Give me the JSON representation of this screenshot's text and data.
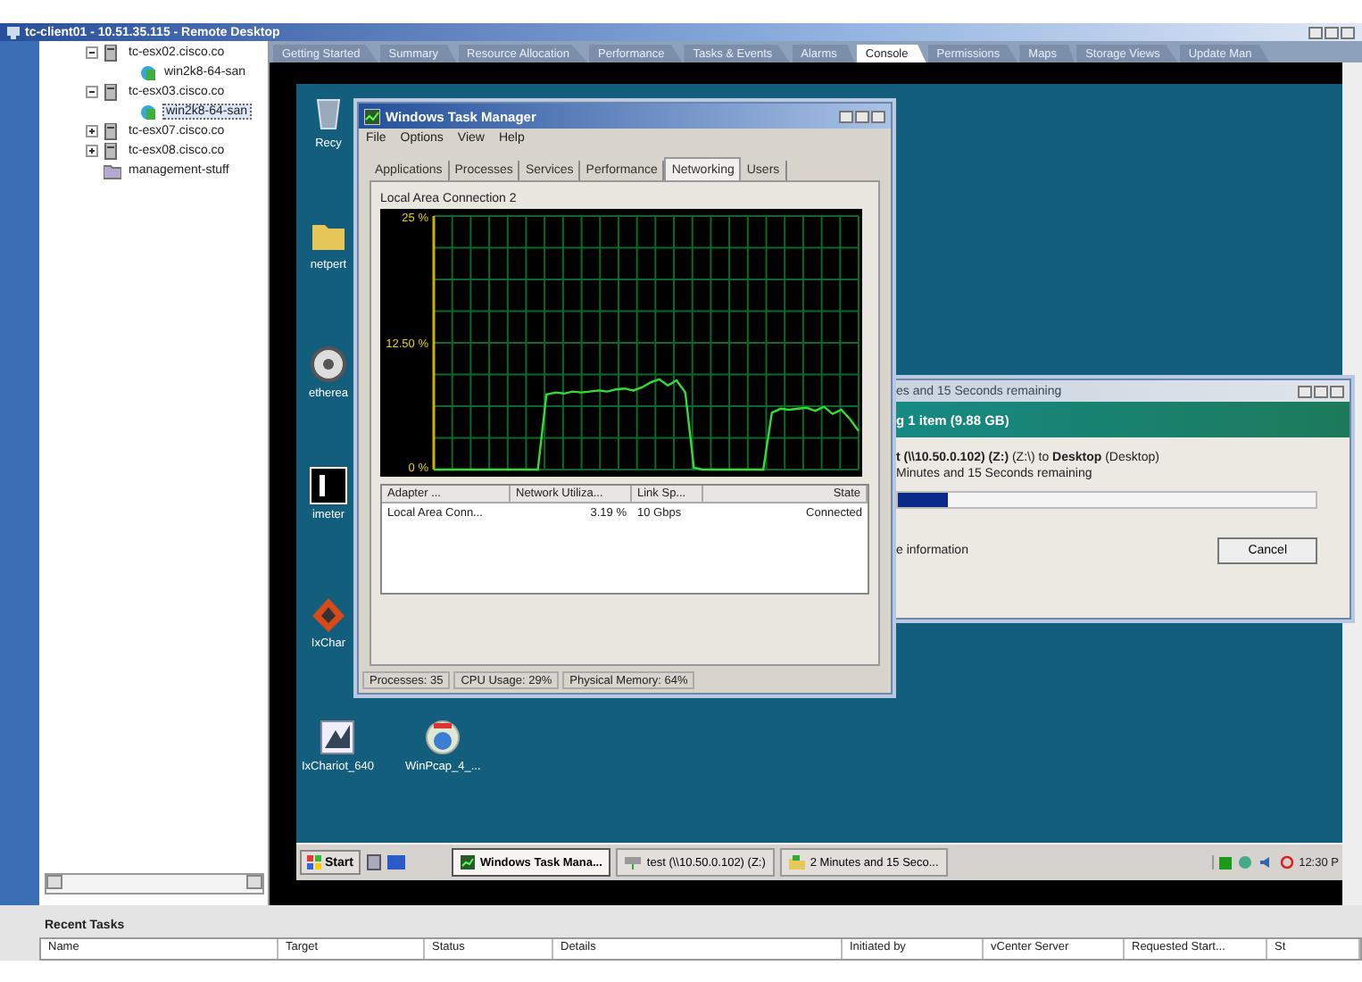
{
  "remote_desktop": {
    "title": "tc-client01 - 10.51.35.115 - Remote Desktop"
  },
  "inventory_tree": [
    {
      "label": "tc-esx02.cisco.co",
      "kind": "host",
      "expanded": true,
      "selected": false,
      "children": [
        {
          "label": "win2k8-64-san",
          "kind": "vm",
          "selected": false
        }
      ]
    },
    {
      "label": "tc-esx03.cisco.co",
      "kind": "host",
      "expanded": true,
      "selected": false,
      "children": [
        {
          "label": "win2k8-64-san",
          "kind": "vm",
          "selected": true
        }
      ]
    },
    {
      "label": "tc-esx07.cisco.co",
      "kind": "host",
      "expanded": false,
      "selected": false
    },
    {
      "label": "tc-esx08.cisco.co",
      "kind": "host",
      "expanded": false,
      "selected": false
    },
    {
      "label": "management-stuff",
      "kind": "folder",
      "selected": false
    }
  ],
  "tabs": [
    {
      "label": "Getting Started",
      "selected": false
    },
    {
      "label": "Summary",
      "selected": false
    },
    {
      "label": "Resource Allocation",
      "selected": false
    },
    {
      "label": "Performance",
      "selected": false
    },
    {
      "label": "Tasks & Events",
      "selected": false
    },
    {
      "label": "Alarms",
      "selected": false
    },
    {
      "label": "Console",
      "selected": true
    },
    {
      "label": "Permissions",
      "selected": false
    },
    {
      "label": "Maps",
      "selected": false
    },
    {
      "label": "Storage Views",
      "selected": false
    },
    {
      "label": "Update Man",
      "selected": false
    }
  ],
  "desktop": {
    "side_icons": [
      {
        "label": "Recy",
        "kind": "recycle"
      },
      {
        "label": "netpert",
        "kind": "folder"
      },
      {
        "label": "etherea",
        "kind": "disc"
      },
      {
        "label": "imeter",
        "kind": "tile"
      },
      {
        "label": "IxChar",
        "kind": "app"
      }
    ],
    "bottom_icons": [
      {
        "label": "IxChariot_640",
        "kind": "chart"
      },
      {
        "label": "WinPcap_4_...",
        "kind": "globe"
      }
    ]
  },
  "task_manager": {
    "title": "Windows Task Manager",
    "menu": [
      "File",
      "Options",
      "View",
      "Help"
    ],
    "tabs": [
      {
        "label": "Applications",
        "selected": false
      },
      {
        "label": "Processes",
        "selected": false
      },
      {
        "label": "Services",
        "selected": false
      },
      {
        "label": "Performance",
        "selected": false
      },
      {
        "label": "Networking",
        "selected": true
      },
      {
        "label": "Users",
        "selected": false
      }
    ],
    "group_label": "Local Area Connection 2",
    "chart_data": {
      "type": "line",
      "grid": true,
      "ylim": [
        0,
        25
      ],
      "yticks": [
        {
          "value": 0,
          "label": "0 %"
        },
        {
          "value": 12.5,
          "label": "12.50 %"
        },
        {
          "value": 25,
          "label": "25 %"
        }
      ],
      "series": [
        {
          "color": "#33dd33",
          "values": [
            0,
            0,
            0,
            0,
            0,
            0,
            0,
            0,
            0,
            0,
            0,
            0,
            0,
            7.4,
            7.6,
            7.5,
            7.7,
            7.6,
            7.7,
            7.8,
            7.7,
            7.9,
            8.0,
            7.8,
            8.1,
            8.6,
            8.9,
            8.3,
            8.8,
            7.6,
            0.2,
            0,
            0,
            0,
            0,
            0,
            0,
            0,
            0,
            5.6,
            6.0,
            5.9,
            6.0,
            6.1,
            5.8,
            6.2,
            5.5,
            5.9,
            5.0,
            3.8
          ]
        }
      ]
    },
    "columns": [
      "Adapter ...",
      "Network Utiliza...",
      "Link Sp...",
      "State"
    ],
    "rows": [
      [
        "Local Area Conn...",
        "3.19 %",
        "10 Gbps",
        "Connected"
      ]
    ],
    "status": [
      "Processes: 35",
      "CPU Usage: 29%",
      "Physical Memory: 64%"
    ]
  },
  "copy_dialog": {
    "title": "es and 15 Seconds remaining",
    "header": "g 1 item (9.88 GB)",
    "route": "**t (\\\\10.50.0.102) (Z:)** (Z:\\) to **Desktop** (Desktop)",
    "remaining": "Minutes and 15 Seconds remaining",
    "level": 0.12,
    "more": "e information",
    "cancel": "Cancel"
  },
  "taskbar": {
    "start": "Start",
    "tasks": [
      {
        "label": "Windows Task Mana...",
        "kind": "taskmgr",
        "selected": true
      },
      {
        "label": "test (\\\\10.50.0.102) (Z:)",
        "kind": "drive",
        "selected": false
      },
      {
        "label": "2 Minutes and 15 Seco...",
        "kind": "copy",
        "selected": false
      }
    ],
    "clock": "12:30 P"
  },
  "recent_tasks": {
    "title": "Recent Tasks",
    "columns": [
      "Name",
      "Target",
      "Status",
      "Details",
      "Initiated by",
      "vCenter Server",
      "Requested Start...",
      "St"
    ]
  }
}
